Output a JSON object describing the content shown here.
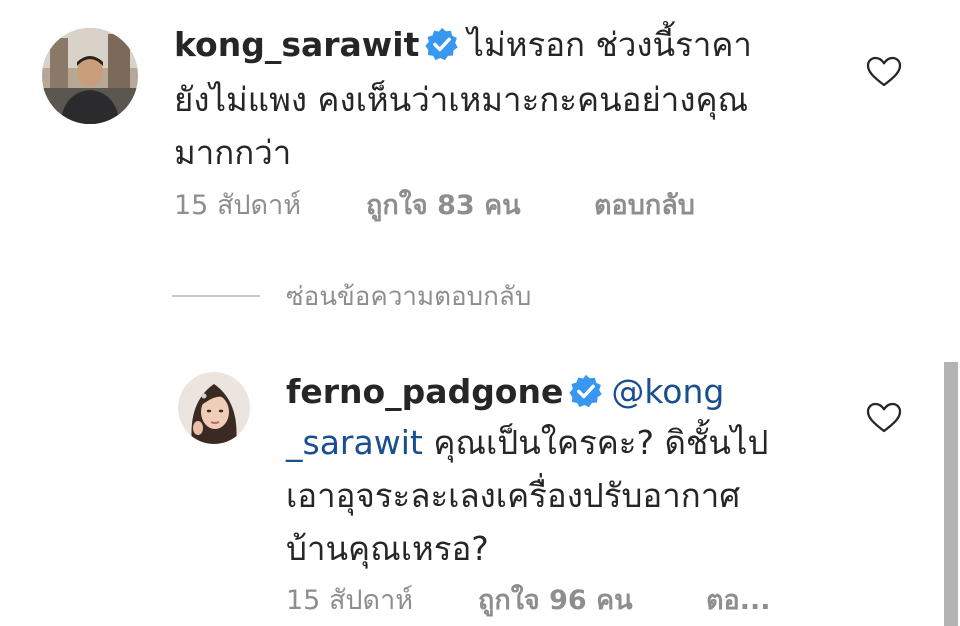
{
  "comments": [
    {
      "username": "kong_sarawit",
      "lines": [
        "ไม่หรอก ช่วงนี้ราคา",
        "ยังไม่แพง คงเห็นว่าเหมาะกะคนอย่างคุณ",
        "มากกว่า"
      ],
      "time": "15 สัปดาห์",
      "likes": "ถูกใจ 83 คน",
      "reply": "ตอบกลับ",
      "verified": true,
      "avatar_icon": "profile-photo-man"
    },
    {
      "username": "ferno_padgone",
      "mention_part1": "@kong",
      "mention_part2": "_sarawit",
      "lines": [
        "คุณเป็นใครคะ? ดิชั้นไป",
        "เอาอุจระละเลงเครื่องปรับอากาศ",
        "บ้านคุณเหรอ?"
      ],
      "time": "15 สัปดาห์",
      "likes": "ถูกใจ 96 คน",
      "reply": "ตอ...",
      "verified": true,
      "avatar_icon": "profile-photo-woman"
    }
  ],
  "hide_replies_label": "ซ่อนข้อความตอบกลับ",
  "colors": {
    "verified_badge": "#3897f0",
    "meta_text": "#8e8e8e",
    "mention": "#1a4f8f"
  }
}
